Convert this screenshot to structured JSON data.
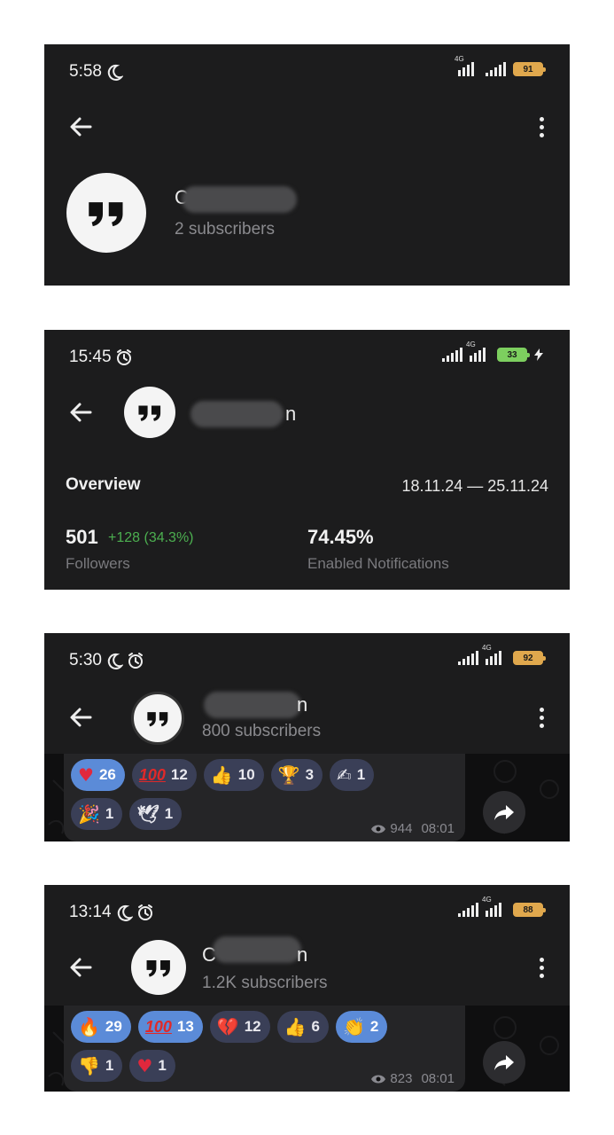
{
  "panels": [
    {
      "time": "5:58",
      "status_icons": [
        "moon-icon"
      ],
      "battery": "91",
      "subscribers": "2 subscribers",
      "name_fragment": "C"
    },
    {
      "time": "15:45",
      "status_icons": [
        "alarm-icon"
      ],
      "battery": "33",
      "name_fragment": "n",
      "overview": {
        "title": "Overview",
        "range": "18.11.24 — 25.11.24",
        "followers_value": "501",
        "followers_delta": "+128 (34.3%)",
        "followers_label": "Followers",
        "notif_value": "74.45%",
        "notif_label": "Enabled Notifications"
      }
    },
    {
      "time": "5:30",
      "status_icons": [
        "moon-icon",
        "alarm-icon"
      ],
      "battery": "92",
      "name_fragment": "n",
      "subscribers": "800 subscribers",
      "reactions_row1": [
        {
          "emoji": "heart",
          "count": "26",
          "highlight": true
        },
        {
          "emoji": "hundred",
          "count": "12",
          "highlight": false
        },
        {
          "emoji": "thumbs-up",
          "count": "10",
          "highlight": false
        },
        {
          "emoji": "trophy",
          "count": "3",
          "highlight": false
        },
        {
          "emoji": "writing-hand",
          "count": "1",
          "highlight": false
        }
      ],
      "reactions_row2": [
        {
          "emoji": "party-popper",
          "count": "1",
          "highlight": false
        },
        {
          "emoji": "dove",
          "count": "1",
          "highlight": false
        }
      ],
      "views": "944",
      "post_time": "08:01"
    },
    {
      "time": "13:14",
      "status_icons": [
        "moon-icon",
        "alarm-icon"
      ],
      "battery": "88",
      "name_fragment": "C",
      "name_fragment_end": "n",
      "subscribers": "1.2K subscribers",
      "reactions_row1": [
        {
          "emoji": "fire",
          "count": "29",
          "highlight": true
        },
        {
          "emoji": "hundred",
          "count": "13",
          "highlight": true
        },
        {
          "emoji": "broken-heart",
          "count": "12",
          "highlight": false
        },
        {
          "emoji": "thumbs-up",
          "count": "6",
          "highlight": false
        },
        {
          "emoji": "clapping",
          "count": "2",
          "highlight": true
        }
      ],
      "reactions_row2": [
        {
          "emoji": "thumbs-down",
          "count": "1",
          "highlight": false
        },
        {
          "emoji": "heart",
          "count": "1",
          "highlight": false
        }
      ],
      "views": "823",
      "post_time": "08:01"
    }
  ],
  "colors": {
    "panel_bg": "#1c1c1d",
    "reaction_bg": "#3a3f57",
    "reaction_highlight": "#5b8bd8",
    "delta_green": "#4caf50",
    "battery_orange": "#e0a84d",
    "battery_green": "#7dcf5f"
  }
}
